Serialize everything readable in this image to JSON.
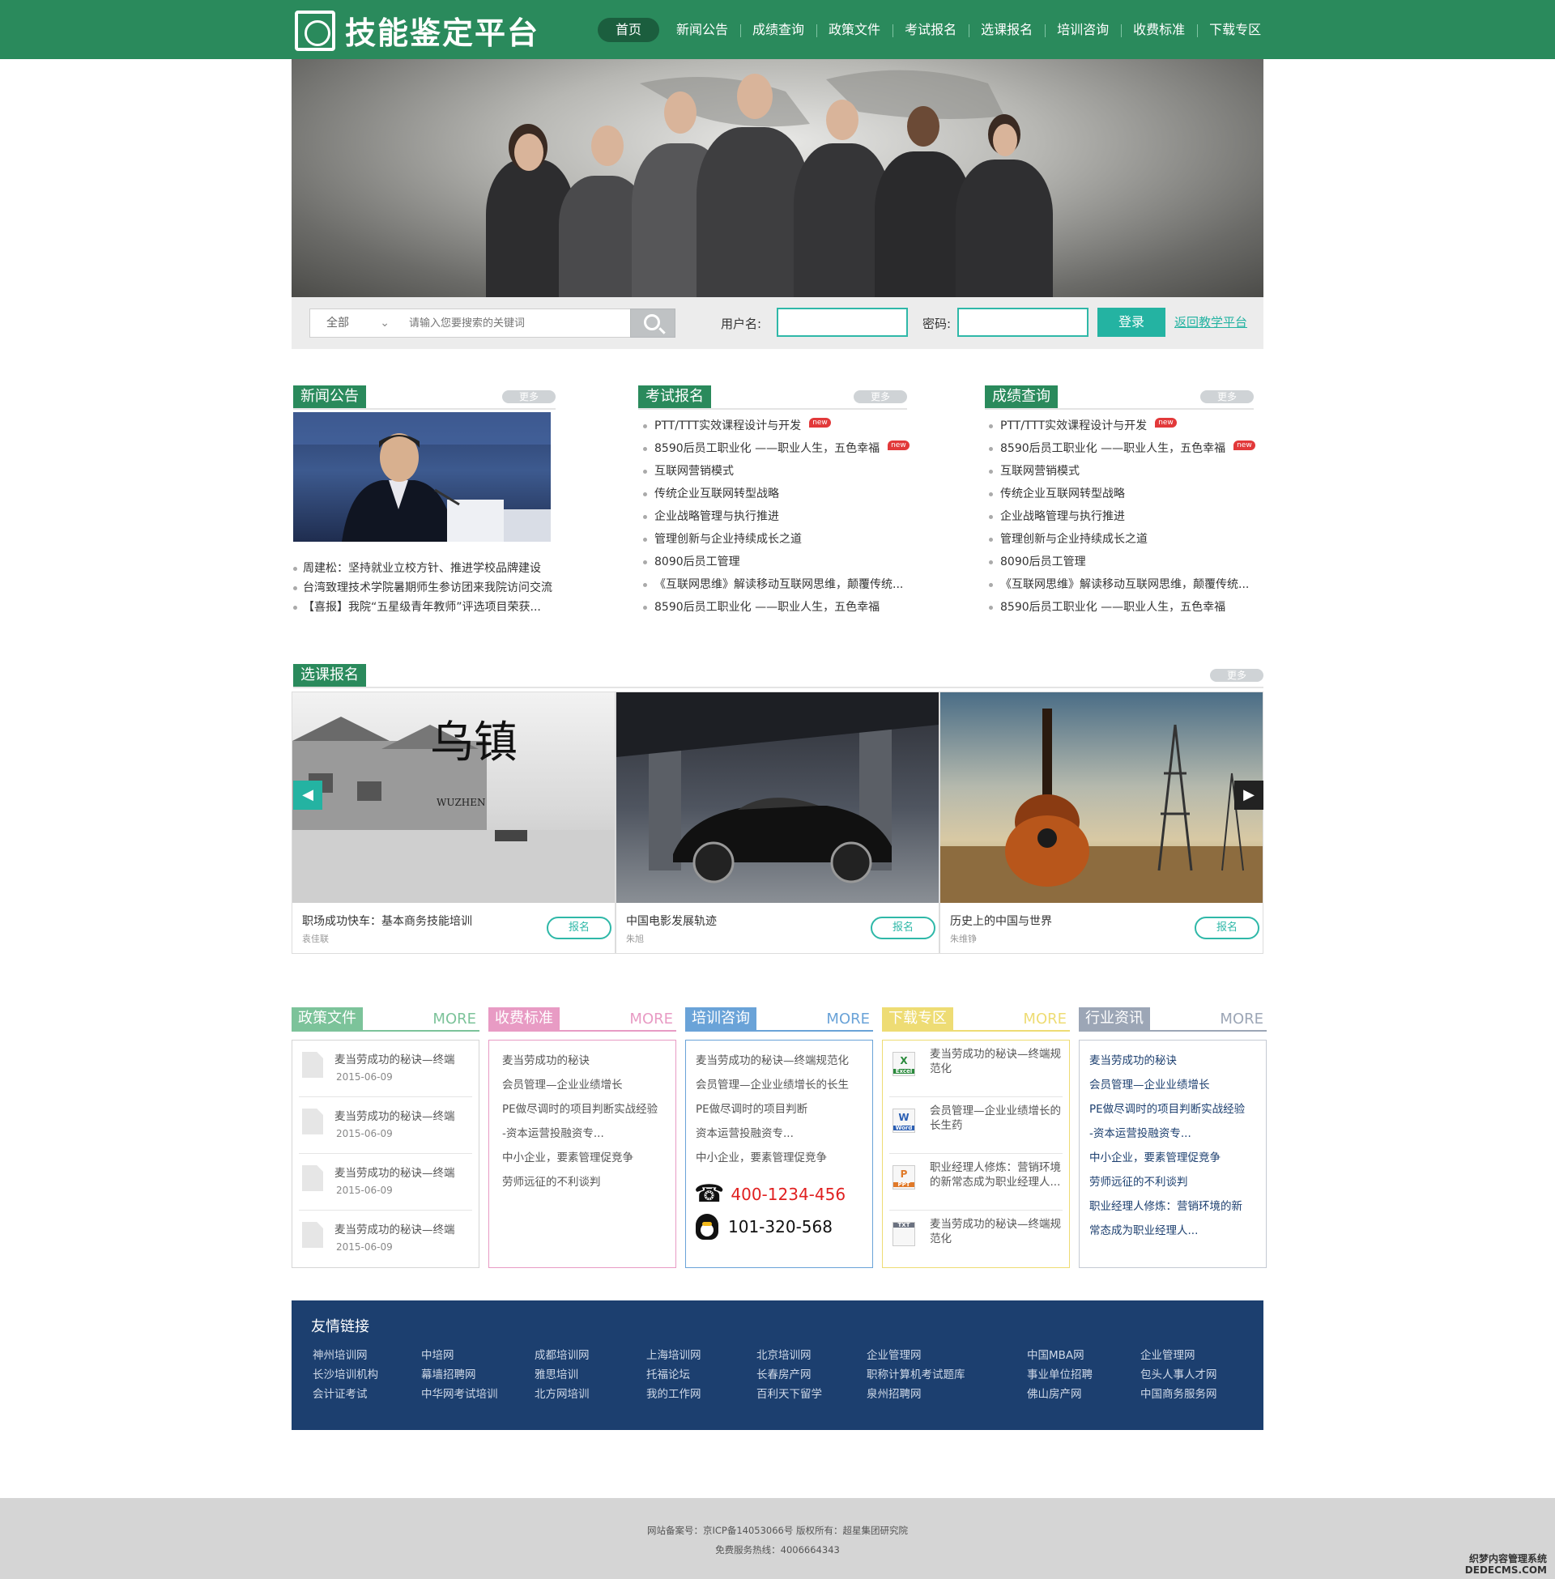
{
  "header": {
    "brand": "技能鉴定平台",
    "nav": [
      "首页",
      "新闻公告",
      "成绩查询",
      "政策文件",
      "考试报名",
      "选课报名",
      "培训咨询",
      "收费标准",
      "下载专区"
    ]
  },
  "search": {
    "scope": "全部",
    "placeholder": "请输入您要搜索的关键词"
  },
  "login": {
    "user_label": "用户名:",
    "pass_label": "密码:",
    "button": "登录",
    "back_link": "返回教学平台"
  },
  "news": {
    "title": "新闻公告",
    "more": "更多",
    "items": [
      "周建松：坚持就业立校方针、推进学校品牌建设",
      "台湾致理技术学院暑期师生参访团来我院访问交流",
      "【喜报】我院“五星级青年教师”评选项目荣获..."
    ]
  },
  "exam": {
    "title": "考试报名",
    "more": "更多",
    "new_tag": "new",
    "items": [
      "PTT/TTT实效课程设计与开发",
      "8590后员工职业化 ——职业人生，五色幸福",
      "互联网营销模式",
      "传统企业互联网转型战略",
      "企业战略管理与执行推进",
      "管理创新与企业持续成长之道",
      "8090后员工管理",
      "《互联网思维》解读移动互联网思维，颠覆传统...",
      "8590后员工职业化 ——职业人生，五色幸福"
    ]
  },
  "score": {
    "title": "成绩查询",
    "more": "更多",
    "new_tag": "new",
    "items": [
      "PTT/TTT实效课程设计与开发",
      "8590后员工职业化 ——职业人生，五色幸福",
      "互联网营销模式",
      "传统企业互联网转型战略",
      "企业战略管理与执行推进",
      "管理创新与企业持续成长之道",
      "8090后员工管理",
      "《互联网思维》解读移动互联网思维，颠覆传统...",
      "8590后员工职业化 ——职业人生，五色幸福"
    ]
  },
  "courses": {
    "title": "选课报名",
    "more": "更多",
    "wuzhen_script": "乌镇",
    "wuzhen_latin": "WUZHEN",
    "items": [
      {
        "title": "职场成功快车：基本商务技能培训",
        "author": "袁佳联",
        "button": "报名"
      },
      {
        "title": "中国电影发展轨迹",
        "author": "朱旭",
        "button": "报名"
      },
      {
        "title": "历史上的中国与世界",
        "author": "朱维铮",
        "button": "报名"
      }
    ]
  },
  "policy": {
    "title": "政策文件",
    "more": "MORE",
    "items": [
      {
        "title": "麦当劳成功的秘诀—终端",
        "date": "2015-06-09"
      },
      {
        "title": "麦当劳成功的秘诀—终端",
        "date": "2015-06-09"
      },
      {
        "title": "麦当劳成功的秘诀—终端",
        "date": "2015-06-09"
      },
      {
        "title": "麦当劳成功的秘诀—终端",
        "date": "2015-06-09"
      }
    ]
  },
  "fees": {
    "title": "收费标准",
    "more": "MORE",
    "items": [
      "麦当劳成功的秘诀",
      "会员管理—企业业绩增长",
      "PE做尽调时的项目判断实战经验",
      "-资本运营投融资专...",
      "中小企业，要素管理促竞争",
      "劳师远征的不利谈判"
    ]
  },
  "consult": {
    "title": "培训咨询",
    "more": "MORE",
    "items": [
      "麦当劳成功的秘诀—终端规范化",
      "会员管理—企业业绩增长的长生",
      "PE做尽调时的项目判断",
      "资本运营投融资专...",
      "中小企业，要素管理促竞争"
    ],
    "phone": "400-1234-456",
    "qq": "101-320-568"
  },
  "download": {
    "title": "下载专区",
    "more": "MORE",
    "items": [
      {
        "title": "麦当劳成功的秘诀—终端规范化",
        "icon": "X",
        "type": "Excel"
      },
      {
        "title": "会员管理—企业业绩增长的长生药",
        "icon": "W",
        "type": "Word"
      },
      {
        "title": "职业经理人修炼：营销环境的新常态成为职业经理人...",
        "icon": "P",
        "type": "PPT"
      },
      {
        "title": "麦当劳成功的秘诀—终端规范化",
        "icon": "",
        "type": "TXT"
      }
    ]
  },
  "industry": {
    "title": "行业资讯",
    "more": "MORE",
    "items": [
      "麦当劳成功的秘诀",
      "会员管理—企业业绩增长",
      "PE做尽调时的项目判断实战经验",
      "-资本运营投融资专...",
      "中小企业，要素管理促竞争",
      "劳师远征的不利谈判",
      "职业经理人修炼：营销环境的新",
      "常态成为职业经理人..."
    ]
  },
  "friends": {
    "title": "友情链接",
    "columns": [
      [
        "神州培训网",
        "长沙培训机构",
        "会计证考试"
      ],
      [
        "中培网",
        "幕墙招聘网",
        "中华网考试培训"
      ],
      [
        "成都培训网",
        "雅思培训",
        "北方网培训"
      ],
      [
        "上海培训网",
        "托福论坛",
        "我的工作网"
      ],
      [
        "北京培训网",
        "长春房产网",
        "百利天下留学"
      ],
      [
        "企业管理网",
        "职称计算机考试题库",
        "泉州招聘网"
      ],
      [
        "中国MBA网",
        "事业单位招聘",
        "佛山房产网"
      ],
      [
        "企业管理网",
        "包头人事人才网",
        "中国商务服务网"
      ]
    ]
  },
  "footer": {
    "line1": "网站备案号：京ICP备14053066号 版权所有：超星集团研究院",
    "line2": "免费服务热线：4006664343",
    "watermark1": "织梦内容管理系统",
    "watermark2": "DEDECMS.COM"
  },
  "colors": {
    "brand_green": "#2a8a5c",
    "teal": "#24b3a2",
    "policy": "#7cc39a",
    "fees": "#e89bc4",
    "consult": "#6aa3d8",
    "download": "#eedc74",
    "industry": "#9ca6b6",
    "friends_bg": "#1c3f6f"
  }
}
